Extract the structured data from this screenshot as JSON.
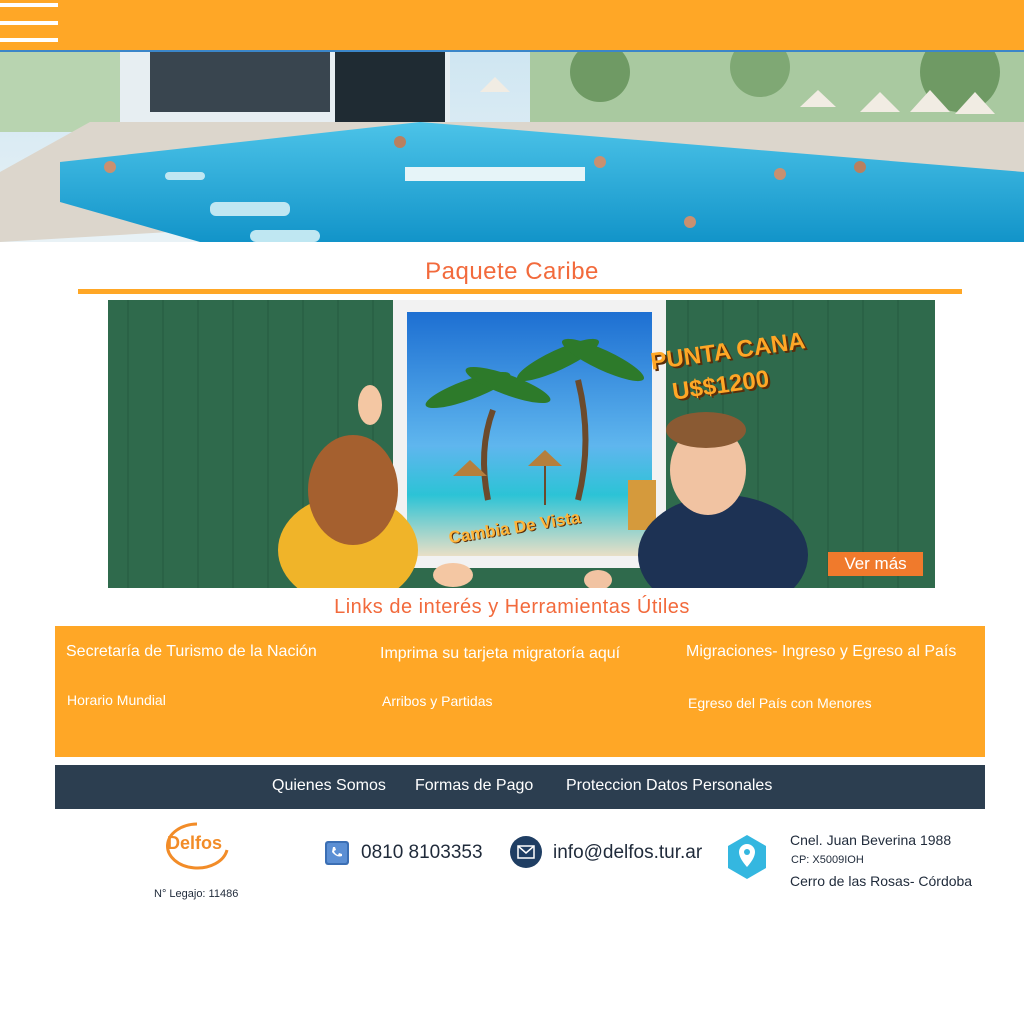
{
  "colors": {
    "accent": "#ffa726",
    "title_orange": "#f26a3c",
    "nav_dark": "#2c3e50",
    "hero_blue": "#3b86c9"
  },
  "header": {
    "menu_icon": "hamburger-menu-icon"
  },
  "hero": {
    "image": "resort-pool-photo"
  },
  "package": {
    "title": "Paquete Caribe",
    "destination": "PUNTA CANA",
    "price": "U$$1200",
    "slogan": "Cambia De Vista",
    "more_button": "Ver más"
  },
  "links": {
    "title": "Links de interés y Herramientas Útiles",
    "items": [
      "Secretaría de Turismo de la Nación",
      "Imprima su tarjeta migratoría aquí",
      "Migraciones- Ingreso y Egreso al País",
      "Horario Mundial",
      "Arribos y Partidas",
      "Egreso del País con Menores"
    ]
  },
  "footer_nav": {
    "items": [
      "Quienes Somos",
      "Formas de Pago",
      "Proteccion Datos Personales"
    ]
  },
  "contact": {
    "logo_text": "Delfos",
    "legajo": "N° Legajo: 11486",
    "phone": "0810 8103353",
    "email": "info@delfos.tur.ar",
    "address_line1": "Cnel. Juan Beverina 1988",
    "address_line2": "CP: X5009IOH",
    "address_line3": "Cerro de las Rosas- Córdoba",
    "icons": [
      "phone-icon",
      "mail-icon",
      "location-pin-icon"
    ]
  }
}
